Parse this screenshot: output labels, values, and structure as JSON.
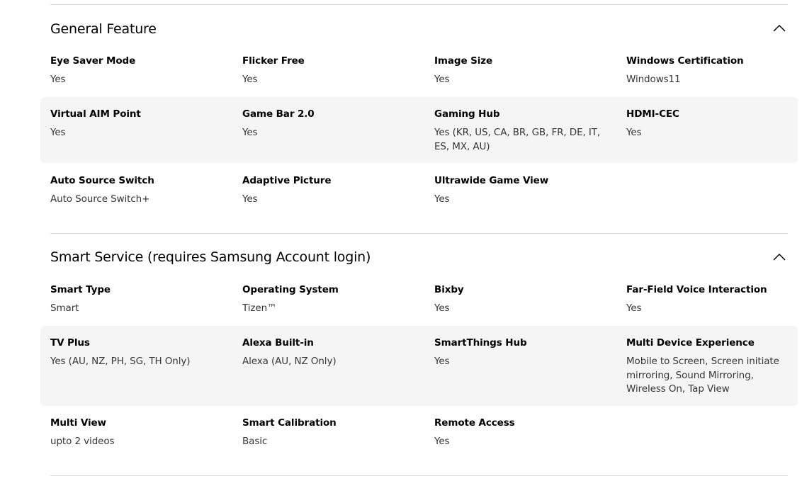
{
  "sections": [
    {
      "title": "General Feature",
      "rows": [
        [
          {
            "label": "Eye Saver Mode",
            "value": "Yes"
          },
          {
            "label": "Flicker Free",
            "value": "Yes"
          },
          {
            "label": "Image Size",
            "value": "Yes"
          },
          {
            "label": "Windows Certification",
            "value": "Windows11"
          }
        ],
        [
          {
            "label": "Virtual AIM Point",
            "value": "Yes"
          },
          {
            "label": "Game Bar 2.0",
            "value": "Yes"
          },
          {
            "label": "Gaming Hub",
            "value": "Yes (KR, US, CA, BR, GB, FR, DE, IT, ES, MX, AU)"
          },
          {
            "label": "HDMI-CEC",
            "value": "Yes"
          }
        ],
        [
          {
            "label": "Auto Source Switch",
            "value": "Auto Source Switch+"
          },
          {
            "label": "Adaptive Picture",
            "value": "Yes"
          },
          {
            "label": "Ultrawide Game View",
            "value": "Yes"
          }
        ]
      ]
    },
    {
      "title": "Smart Service (requires Samsung Account login)",
      "rows": [
        [
          {
            "label": "Smart Type",
            "value": "Smart"
          },
          {
            "label": "Operating System",
            "value": "Tizen™"
          },
          {
            "label": "Bixby",
            "value": "Yes"
          },
          {
            "label": "Far-Field Voice Interaction",
            "value": "Yes"
          }
        ],
        [
          {
            "label": "TV Plus",
            "value": "Yes (AU, NZ, PH, SG, TH Only)"
          },
          {
            "label": "Alexa Built-in",
            "value": "Alexa (AU, NZ Only)"
          },
          {
            "label": "SmartThings Hub",
            "value": "Yes"
          },
          {
            "label": "Multi Device Experience",
            "value": "Mobile to Screen, Screen initiate mirroring, Sound Mirroring, Wireless On, Tap View"
          }
        ],
        [
          {
            "label": "Multi View",
            "value": "upto 2 videos"
          },
          {
            "label": "Smart Calibration",
            "value": "Basic"
          },
          {
            "label": "Remote Access",
            "value": "Yes"
          }
        ]
      ]
    }
  ]
}
